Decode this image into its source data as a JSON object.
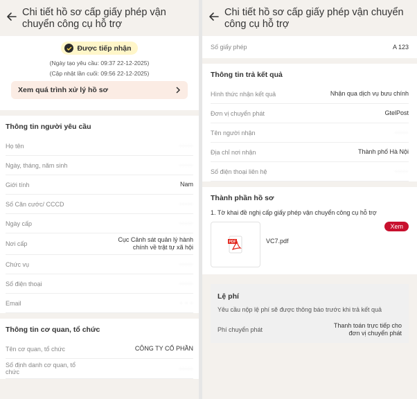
{
  "left": {
    "title": "Chi tiết hồ sơ cấp giấy phép vận chuyển công cụ hỗ trợ",
    "status": "Được tiếp nhận",
    "created": "(Ngày tạo yêu cầu: 09:37 22-12-2025)",
    "updated": "(Cập nhật lần cuối: 09:56 22-12-2025)",
    "process_link": "Xem quá trình xử lý hồ sơ",
    "requester": {
      "title": "Thông tin người yêu cầu",
      "rows": [
        {
          "label": "Họ tên",
          "value": "·····"
        },
        {
          "label": "Ngày, tháng, năm sinh",
          "value": "·····"
        },
        {
          "label": "Giới tính",
          "value": "Nam"
        },
        {
          "label": "Số Căn cước/ CCCD",
          "value": "·····"
        },
        {
          "label": "Ngày cấp",
          "value": "·····"
        },
        {
          "label": "Nơi cấp",
          "value": "Cục Cảnh sát quản lý hành chính về trật tự xã hội"
        },
        {
          "label": "Chức vụ",
          "value": "·····"
        },
        {
          "label": "Số điện thoại",
          "value": "·····"
        },
        {
          "label": "Email",
          "value": "· · ·"
        }
      ]
    },
    "org": {
      "title": "Thông tin cơ quan, tổ chức",
      "rows": [
        {
          "label": "Tên cơ quan, tổ chức",
          "value": "CÔNG TY CỔ PHẦN"
        },
        {
          "label": "Số định danh cơ quan, tổ chức",
          "value": "·····"
        }
      ]
    }
  },
  "right": {
    "title": "Chi tiết hồ sơ cấp giấy phép vận chuyển công cụ hỗ trợ",
    "license_label": "Số giấy phép",
    "license_value": "A 123",
    "result": {
      "title": "Thông tin trả kết quả",
      "rows": [
        {
          "label": "Hình thức nhận kết quả",
          "value": "Nhận qua dịch vụ bưu chính"
        },
        {
          "label": "Đơn vị chuyển phát",
          "value": "GtelPost"
        },
        {
          "label": "Tên người nhận",
          "value": "·····"
        },
        {
          "label": "Địa chỉ nơi nhận",
          "value": "Thành phố Hà Nội"
        },
        {
          "label": "Số điện thoại liên hệ",
          "value": "·····"
        }
      ]
    },
    "docs": {
      "title": "Thành phần hồ sơ",
      "item": "1. Tờ khai đề nghị cấp giấy phép vận chuyển công cụ hỗ trợ",
      "file_name": "VC7.pdf",
      "view_label": "Xem",
      "pdf_tag": "PDF"
    },
    "fee": {
      "title": "Lệ phí",
      "note": "Yêu cầu nộp lệ phí sẽ được thông báo trước khi trả kết quả",
      "label": "Phí chuyển phát",
      "value": "Thanh toán trực tiếp cho đơn vị chuyển phát"
    }
  },
  "colors": {
    "accent": "#c8102e",
    "badge_bg": "#fff6c9",
    "process_bg": "#fbece4"
  }
}
